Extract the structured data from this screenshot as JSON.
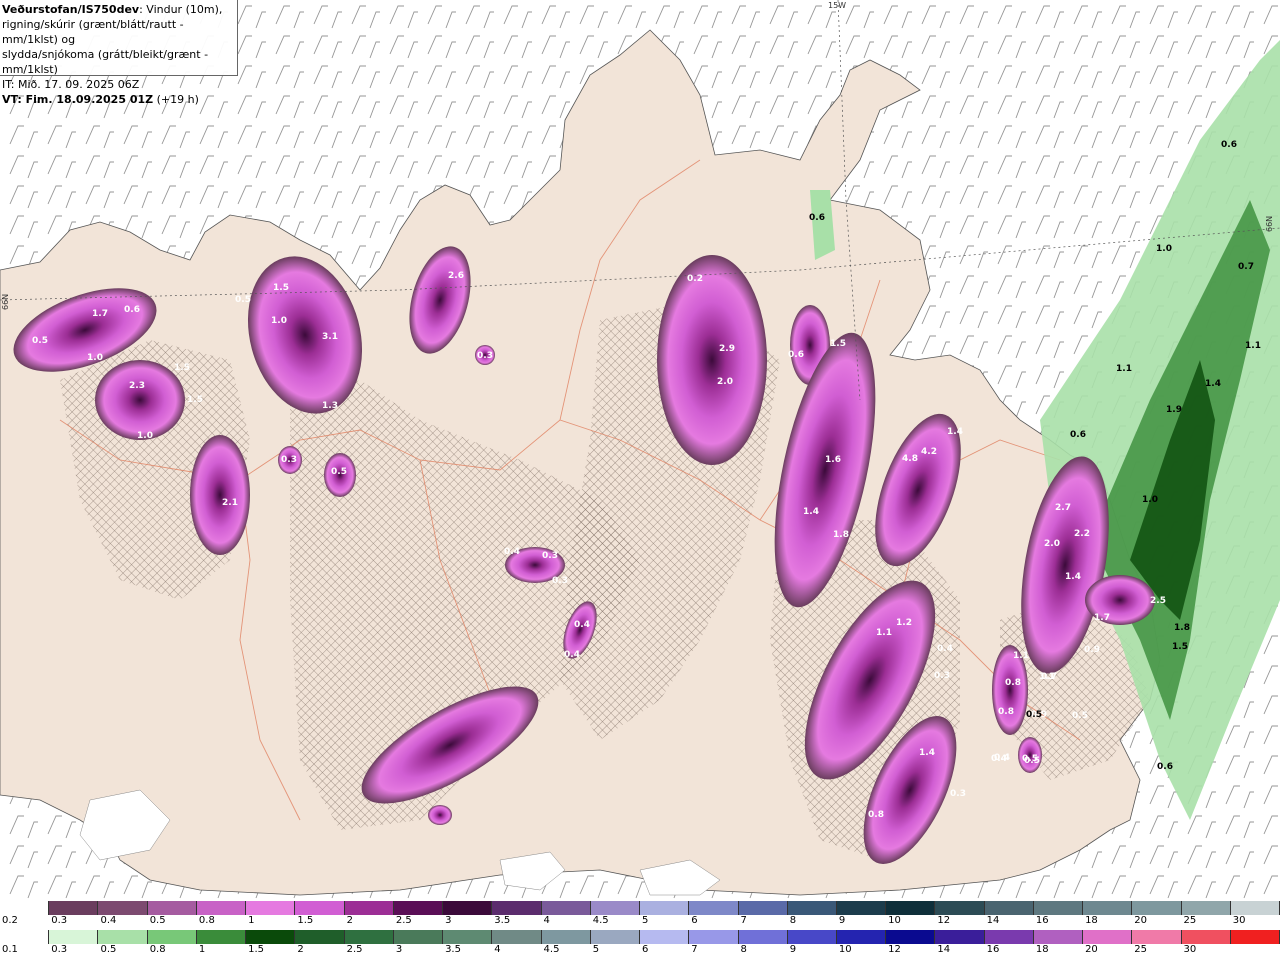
{
  "header": {
    "source": "Veðurstofan/IS750dev",
    "description_1": ": Vindur (10m),",
    "description_2": "rigning/skúrir (grænt/blátt/rautt - mm/1klst) og",
    "description_3": "slydda/snjókoma (grátt/bleikt/grænt - mm/1klst)",
    "it_line": "IT: Mið. 17. 09. 2025 06Z",
    "vt_line": "VT: Fim. 18.09.2025 01Z",
    "vt_offset": " (+19 h)"
  },
  "map_labels": {
    "lon_label": "15W",
    "lat_label_right": "66N",
    "lat_label_left": "66N"
  },
  "precip_values": [
    {
      "text": "1.7",
      "fill": "#ffffff"
    },
    {
      "text": "0.6",
      "fill": "#ffffff"
    },
    {
      "text": "0.5",
      "fill": "#ffffff"
    },
    {
      "text": "1.0",
      "fill": "#ffffff"
    },
    {
      "text": "2.3",
      "fill": "#ffffff"
    },
    {
      "text": "1.5",
      "fill": "#ffffff"
    },
    {
      "text": "1.5",
      "fill": "#ffffff"
    },
    {
      "text": "1.0",
      "fill": "#ffffff"
    },
    {
      "text": "2.1",
      "fill": "#ffffff"
    },
    {
      "text": "0.5",
      "fill": "#ffffff"
    },
    {
      "text": "1.5",
      "fill": "#ffffff"
    },
    {
      "text": "1.0",
      "fill": "#ffffff"
    },
    {
      "text": "3.1",
      "fill": "#ffffff"
    },
    {
      "text": "1.3",
      "fill": "#ffffff"
    },
    {
      "text": "0.3",
      "fill": "#ffffff"
    },
    {
      "text": "0.5",
      "fill": "#ffffff"
    },
    {
      "text": "2.6",
      "fill": "#ffffff"
    },
    {
      "text": "0.3",
      "fill": "#ffffff"
    },
    {
      "text": "0.2",
      "fill": "#ffffff"
    },
    {
      "text": "2.9",
      "fill": "#ffffff"
    },
    {
      "text": "2.0",
      "fill": "#ffffff"
    },
    {
      "text": "0.6",
      "fill": "#ffffff"
    },
    {
      "text": "1.5",
      "fill": "#ffffff"
    },
    {
      "text": "1.6",
      "fill": "#ffffff"
    },
    {
      "text": "1.4",
      "fill": "#ffffff"
    },
    {
      "text": "1.8",
      "fill": "#ffffff"
    },
    {
      "text": "4.8",
      "fill": "#ffffff"
    },
    {
      "text": "4.2",
      "fill": "#ffffff"
    },
    {
      "text": "1.4",
      "fill": "#ffffff"
    },
    {
      "text": "0.4",
      "fill": "#ffffff"
    },
    {
      "text": "0.3",
      "fill": "#ffffff"
    },
    {
      "text": "0.3",
      "fill": "#ffffff"
    },
    {
      "text": "0.4",
      "fill": "#ffffff"
    },
    {
      "text": "0.4",
      "fill": "#ffffff"
    },
    {
      "text": "1.1",
      "fill": "#ffffff"
    },
    {
      "text": "1.2",
      "fill": "#ffffff"
    },
    {
      "text": "0.4",
      "fill": "#ffffff"
    },
    {
      "text": "0.3",
      "fill": "#ffffff"
    },
    {
      "text": "1.1",
      "fill": "#ffffff"
    },
    {
      "text": "1.1",
      "fill": "#ffffff"
    },
    {
      "text": "0.4",
      "fill": "#ffffff"
    },
    {
      "text": "0.5",
      "fill": "#ffffff"
    },
    {
      "text": "0.5",
      "fill": "#ffffff"
    },
    {
      "text": "1.4",
      "fill": "#ffffff"
    },
    {
      "text": "0.3",
      "fill": "#ffffff"
    },
    {
      "text": "0.8",
      "fill": "#ffffff"
    },
    {
      "text": "2.7",
      "fill": "#ffffff"
    },
    {
      "text": "2.0",
      "fill": "#ffffff"
    },
    {
      "text": "2.2",
      "fill": "#ffffff"
    },
    {
      "text": "1.4",
      "fill": "#ffffff"
    },
    {
      "text": "1.7",
      "fill": "#ffffff"
    },
    {
      "text": "0.9",
      "fill": "#ffffff"
    },
    {
      "text": "0.8",
      "fill": "#ffffff"
    },
    {
      "text": "0.7",
      "fill": "#ffffff"
    },
    {
      "text": "0.8",
      "fill": "#ffffff"
    },
    {
      "text": "0.9",
      "fill": "#ffffff"
    },
    {
      "text": "0.4",
      "fill": "#ffffff"
    },
    {
      "text": "0.5",
      "fill": "#ffffff"
    },
    {
      "text": "2.5",
      "fill": "#ffffff"
    },
    {
      "text": "0.6",
      "fill": "#000000"
    },
    {
      "text": "0.6",
      "fill": "#000000"
    },
    {
      "text": "1.0",
      "fill": "#000000"
    },
    {
      "text": "0.7",
      "fill": "#000000"
    },
    {
      "text": "1.1",
      "fill": "#000000"
    },
    {
      "text": "1.4",
      "fill": "#000000"
    },
    {
      "text": "1.1",
      "fill": "#000000"
    },
    {
      "text": "1.9",
      "fill": "#000000"
    },
    {
      "text": "0.6",
      "fill": "#000000"
    },
    {
      "text": "1.0",
      "fill": "#000000"
    },
    {
      "text": "1.8",
      "fill": "#000000"
    },
    {
      "text": "1.5",
      "fill": "#000000"
    },
    {
      "text": "0.6",
      "fill": "#000000"
    },
    {
      "text": "0.5",
      "fill": "#000000"
    }
  ],
  "legend_snow": {
    "labels": [
      "0.2",
      "0.3",
      "0.4",
      "0.5",
      "0.8",
      "1",
      "1.5",
      "2",
      "2.5",
      "3",
      "3.5",
      "4",
      "4.5",
      "5",
      "6",
      "7",
      "8",
      "9",
      "10",
      "12",
      "14",
      "16",
      "18",
      "20",
      "25",
      "30"
    ],
    "colors": [
      "#6a3d5e",
      "#7c4a70",
      "#a55ba0",
      "#c862c6",
      "#e57ae0",
      "#d15ed3",
      "#9c2e95",
      "#5a0e56",
      "#3b0a3a",
      "#5b2c6d",
      "#7a5a9a",
      "#9a8ac8",
      "#aab0e0",
      "#7e88c8",
      "#5a6aa8",
      "#3a5878",
      "#1c3c4c",
      "#0f2f3a",
      "#2c4b55",
      "#4a6470",
      "#5e7880",
      "#6e8890",
      "#7e989e",
      "#90a6aa",
      "#c8d2d4"
    ]
  },
  "legend_rain": {
    "labels": [
      "0.1",
      "0.3",
      "0.5",
      "0.8",
      "1",
      "1.5",
      "2",
      "2.5",
      "3",
      "3.5",
      "4",
      "4.5",
      "5",
      "6",
      "7",
      "8",
      "9",
      "10",
      "12",
      "14",
      "16",
      "18",
      "20",
      "25",
      "30"
    ],
    "colors": [
      "#d8f5d8",
      "#a8e0a8",
      "#78c878",
      "#3a8c3a",
      "#0a4a0a",
      "#1f5e2a",
      "#2f7040",
      "#4a7a5a",
      "#5e8a72",
      "#708a86",
      "#7e98a0",
      "#9aa8c0",
      "#b6baf0",
      "#9898e8",
      "#7070d8",
      "#4848c8",
      "#2424b0",
      "#0a0a90",
      "#3a1e9a",
      "#7a3aae",
      "#b060c0",
      "#e070c8",
      "#f07aa8",
      "#f05060",
      "#f02020"
    ]
  }
}
